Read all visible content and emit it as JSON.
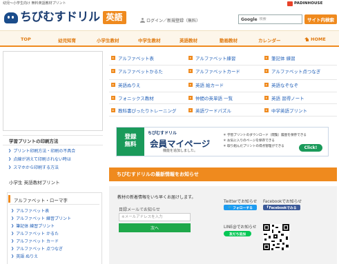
{
  "topbar": {
    "tagline": "幼児〜小学生向け 無料英語教材プリント",
    "brand": "PADINHOUSE"
  },
  "header": {
    "logo_text": "ちびむすドリル",
    "subject_badge": "英語",
    "login_text": "ログイン／新規登録（無料）",
    "search_label": "Google",
    "search_placeholder": "検索",
    "site_search_button": "サイト内検索"
  },
  "nav": {
    "items": [
      "TOP",
      "幼児知育",
      "小学生教材",
      "中学生教材",
      "英語教材",
      "動画教材",
      "カレンダー",
      "HOME"
    ]
  },
  "sidebar": {
    "printing_title": "学習プリントの印刷方法",
    "printing_links": [
      "プリント印刷方法・印刷の不具合",
      "点線が消えて印刷されない時は",
      "スマホから印刷する方法"
    ],
    "english_title": "小学生 英語教材プリント",
    "sub_title": "アルファベット・ローマ字",
    "sub_links": [
      "アルファベット表",
      "アルファベット 練習プリント",
      "筆記体 練習プリント",
      "アルファベット かるた",
      "アルファベット カード",
      "アルファベット 点つなぎ",
      "英語 ぬりえ"
    ]
  },
  "categories": [
    [
      "アルファベット表",
      "アルファベット練習",
      "筆記体 練習"
    ],
    [
      "アルファベットかるた",
      "アルファベットカード",
      "アルファベット点つなぎ"
    ],
    [
      "英語ぬりえ",
      "英語 絵カード",
      "英語なぞなぞ"
    ],
    [
      "フォニックス教材",
      "仲間の英単語 一覧",
      "英語 習得ノート"
    ],
    [
      "教科書ぴったりトレーニング",
      "英語ワードパズル",
      "中学英語プリント"
    ]
  ],
  "banner": {
    "tag_line1": "登録",
    "tag_line2": "無料",
    "logo_small": "ちびむすドリル",
    "headline": "会員マイページ",
    "subline": "機能を追加しました。",
    "bullets": [
      "学習プリントのダウンロード（閲覧）履歴を保存できる",
      "お気に入りのページを保存できる",
      "取り組んだプリントの得点管理ができる"
    ],
    "click_label": "Click!"
  },
  "news": {
    "header": "ちびむすドリルの最新情報をお知らせ",
    "lead": "教材の新着情報をいち早くお届けします。",
    "email_label": "目録メールでお知らせ",
    "email_placeholder": "※メールアドレスを入力",
    "next_button": "次へ",
    "twitter_label": "Twitterでお知らせ",
    "twitter_button": "フォローする",
    "facebook_label": "Facebookでお知らせ",
    "facebook_button": "Facebookでみる",
    "line_label": "LINE@でお知らせ",
    "line_button": "友だち追加"
  },
  "colors": {
    "accent": "#ef8a1e",
    "link": "#2260b8",
    "navy": "#1a3c70",
    "green": "#1fa84a"
  }
}
